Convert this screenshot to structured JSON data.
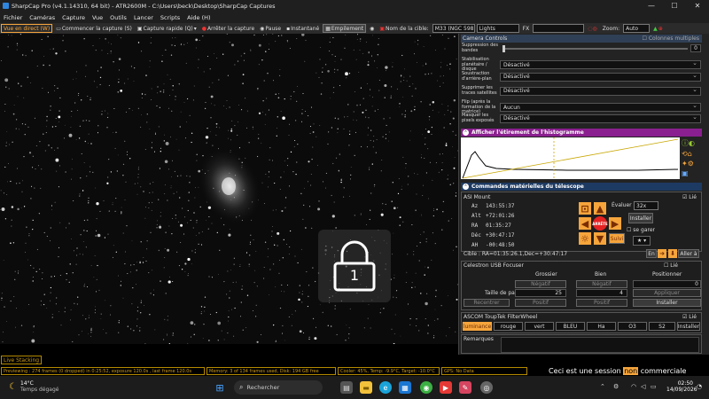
{
  "titlebar": {
    "title": "SharpCap Pro (v4.1.14310, 64 bit) - ATR2600M - C:\\Users\\beck\\Desktop\\SharpCap Captures",
    "min": "—",
    "max": "☐",
    "close": "✕"
  },
  "menu": [
    "Fichier",
    "Caméras",
    "Capture",
    "Vue",
    "Outils",
    "Lancer",
    "Scripts",
    "Aide (H)"
  ],
  "toolbar": {
    "live": "Vue en direct (W)",
    "start": "Commencer la capture (S)",
    "quick": "Capture rapide (Q)",
    "stop": "Arrêter la capture",
    "pause": "Pause",
    "snapshot": "Instantané",
    "stack": "Empilement",
    "target_label": "Nom de la cible:",
    "target": "M33 (NGC 598",
    "frame_type": "Lights",
    "fx": "FX",
    "zoom_label": "Zoom:",
    "zoom": "Auto"
  },
  "panel": {
    "camera_controls": "Camera Controls",
    "multi_cols": "Colonnes multiples",
    "banding_label": "Suppression des bandes",
    "banding_value": "0",
    "rows": [
      {
        "label": "Stabilisation planétaire / disque",
        "value": "Désactivé"
      },
      {
        "label": "Soustraction d'arrière-plan",
        "value": "Désactivé"
      },
      {
        "label": "Supprimer les traces satellites",
        "value": "Désactivé"
      },
      {
        "label": "Flip (après la formation de la matrice)",
        "value": "Aucun"
      },
      {
        "label": "Masquer les pixels exposés",
        "value": "Désactivé"
      }
    ],
    "histogram": "Afficher l'étirement de l'histogramme",
    "telescope": "Commandes matérielles du télescope",
    "mount": "ASI Mount",
    "linked": "Lié",
    "coords": [
      [
        "Az",
        "143:55:37"
      ],
      [
        "Alt",
        "+72:01:26"
      ],
      [
        "RA",
        "01:35:27"
      ],
      [
        "Déc",
        "+30:47:17"
      ],
      [
        "AH",
        "-00:48:50"
      ]
    ],
    "evaluate": "Évaluer",
    "rate": "32x",
    "install": "Installer",
    "se_garer": "se garer",
    "stop_btn": "ARRÊTE",
    "follow": "Suivi",
    "target_coords": "Cible : RA=01:35:26.1,Dec=+30:47:17",
    "en": "En",
    "goto": "Aller à",
    "focuser": "Celestron USB Focuser",
    "focuser_linked": "Lié",
    "focuser_cols": [
      "Grossier",
      "Bien",
      "Positionner"
    ],
    "focuser_vals": {
      "neg1": "Négatif",
      "neg2": "Négatif",
      "pos_val": "0",
      "step_label": "Taille de pas",
      "step1": "25",
      "step2": "4",
      "apply": "Appliquer",
      "recenter": "Recentrer",
      "pos1": "Positif",
      "pos2": "Positif",
      "install": "Installer"
    },
    "filterwheel": "ASCOM ToupTek FilterWheel",
    "fw_linked": "Lié",
    "filters": [
      "luminance",
      "rouge",
      "vert",
      "BLEU",
      "Ha",
      "O3",
      "S2"
    ],
    "fw_install": "Installer",
    "remarks": "Remarques"
  },
  "live_stacking": "Live Stacking",
  "lock_number": "1",
  "status": {
    "preview": "Previewing : 274 frames (0 dropped) in 0:25:52, exposure 120.0s , last frame 120.0s",
    "memory": "Memory: 3 of 134 frames used, Disk: 194 GB free",
    "cooler": "Cooler: 45%, Temp: -9.9°C, Target: -10.0°C",
    "gps": "GPS: No Data"
  },
  "watermark": {
    "a": "Ceci est une session ",
    "b": "non",
    "c": " commerciale"
  },
  "taskbar": {
    "temp": "14°C",
    "weather": "Temps dégagé",
    "search": "Rechercher",
    "time": "02:50",
    "date": "14/09/2026"
  },
  "colors": {
    "accent": "#f6a53c",
    "purple": "#8a1f8f",
    "blue_header": "#1d3a62"
  }
}
